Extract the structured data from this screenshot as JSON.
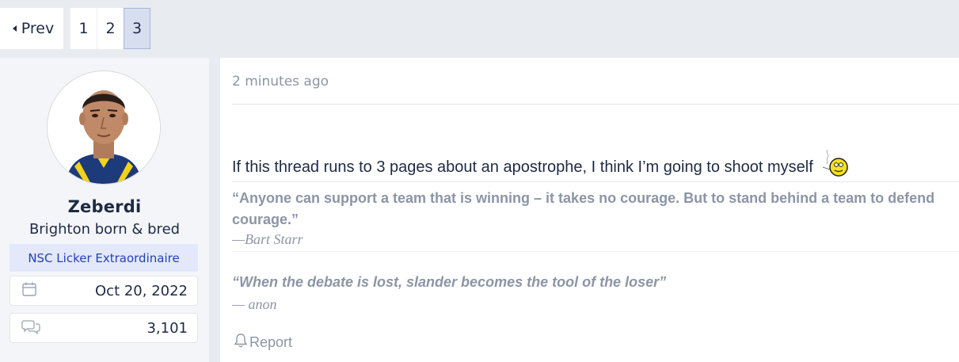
{
  "pagination": {
    "prev_label": "Prev",
    "pages": [
      "1",
      "2",
      "3"
    ],
    "current_page": "3"
  },
  "user": {
    "name": "Zeberdi",
    "title": "Brighton born & bred",
    "banner": "NSC Licker Extraordinaire",
    "joined": "Oct 20, 2022",
    "messages": "3,101"
  },
  "post": {
    "time": "2 minutes ago",
    "body": "If this thread runs to 3 pages about an apostrophe, I think I’m going to shoot myself",
    "signature": {
      "quote1": "“Anyone can support a team that is winning – it takes no courage. But to stand behind a team to defend courage.”",
      "attribution1": "—Bart Starr",
      "quote2": "“When the debate is lost, slander becomes the tool of the loser”",
      "attribution2": "— anon"
    },
    "report_label": "Report"
  },
  "icons": {
    "prev": "caret-left-icon",
    "joined": "calendar-icon",
    "messages": "comments-icon",
    "report": "bell-icon",
    "emoji": "smoking-smiley-icon"
  },
  "colors": {
    "accent_text": "#2541b2",
    "banner_bg": "#e3e8fb",
    "muted_text": "#8c95a5",
    "page_bg": "#e8ebf0"
  }
}
